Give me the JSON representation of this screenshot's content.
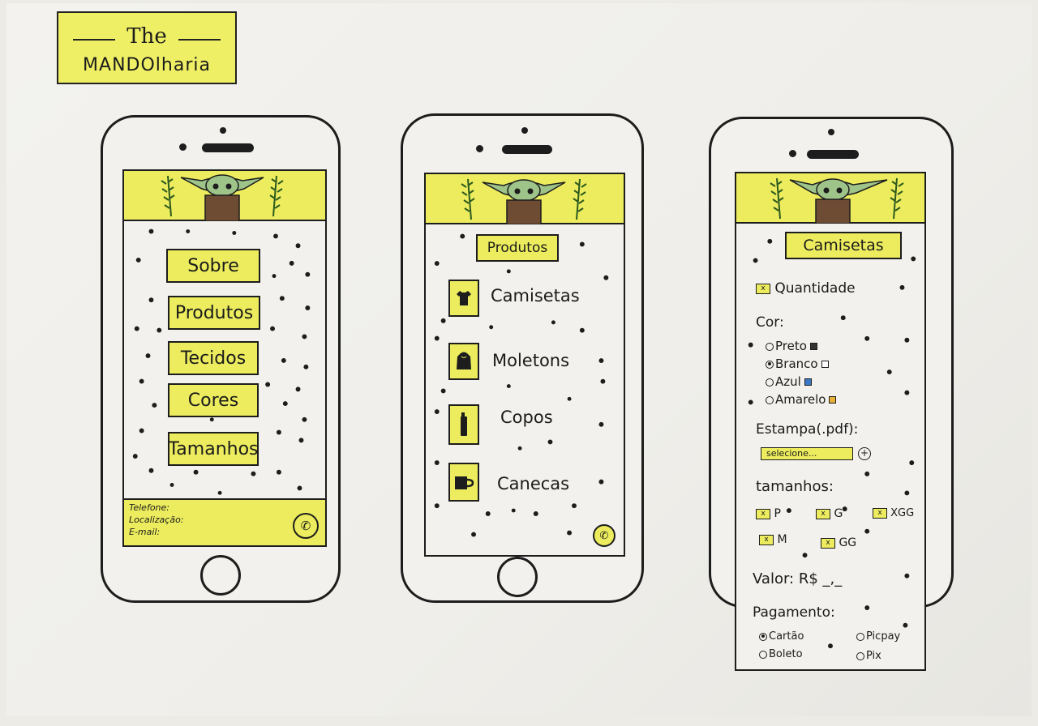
{
  "logo": {
    "line1": "The",
    "line2": "MANDOlharia"
  },
  "colors": {
    "accent": "#ecec5e",
    "ink": "#1d1d1d",
    "paper": "#f2f1ed",
    "blue": "#3b78c8",
    "orange": "#e8b23a",
    "black": "#333333"
  },
  "home": {
    "menu": [
      "Sobre",
      "Produtos",
      "Tecidos",
      "Cores",
      "Tamanhos"
    ],
    "footer": {
      "phone": "Telefone:",
      "location": "Localização:",
      "email": "E-mail:"
    },
    "whatsapp_icon": "whatsapp-icon"
  },
  "products": {
    "title": "Produtos",
    "items": [
      {
        "label": "Camisetas",
        "icon": "tshirt-icon"
      },
      {
        "label": "Moletons",
        "icon": "hoodie-icon"
      },
      {
        "label": "Copos",
        "icon": "cup-icon"
      },
      {
        "label": "Canecas",
        "icon": "mug-icon"
      }
    ]
  },
  "detail": {
    "title": "Camisetas",
    "quantity_label": "Quantidade",
    "color_label": "Cor:",
    "colors": [
      {
        "label": "Preto",
        "selected": false,
        "swatch": "#333333"
      },
      {
        "label": "Branco",
        "selected": true,
        "swatch": "#ffffff"
      },
      {
        "label": "Azul",
        "selected": false,
        "swatch": "#3b78c8"
      },
      {
        "label": "Amarelo",
        "selected": false,
        "swatch": "#e8b23a"
      }
    ],
    "print_label": "Estampa(.pdf):",
    "select_button": "selecione...",
    "add_icon": "plus-icon",
    "sizes_label": "tamanhos:",
    "sizes": [
      "P",
      "G",
      "XGG",
      "M",
      "GG"
    ],
    "value_label": "Valor: R$ _,_",
    "payment_label": "Pagamento:",
    "payments": [
      "Cartão",
      "Picpay",
      "Boleto",
      "Pix"
    ],
    "checkbox_mark": "x"
  }
}
